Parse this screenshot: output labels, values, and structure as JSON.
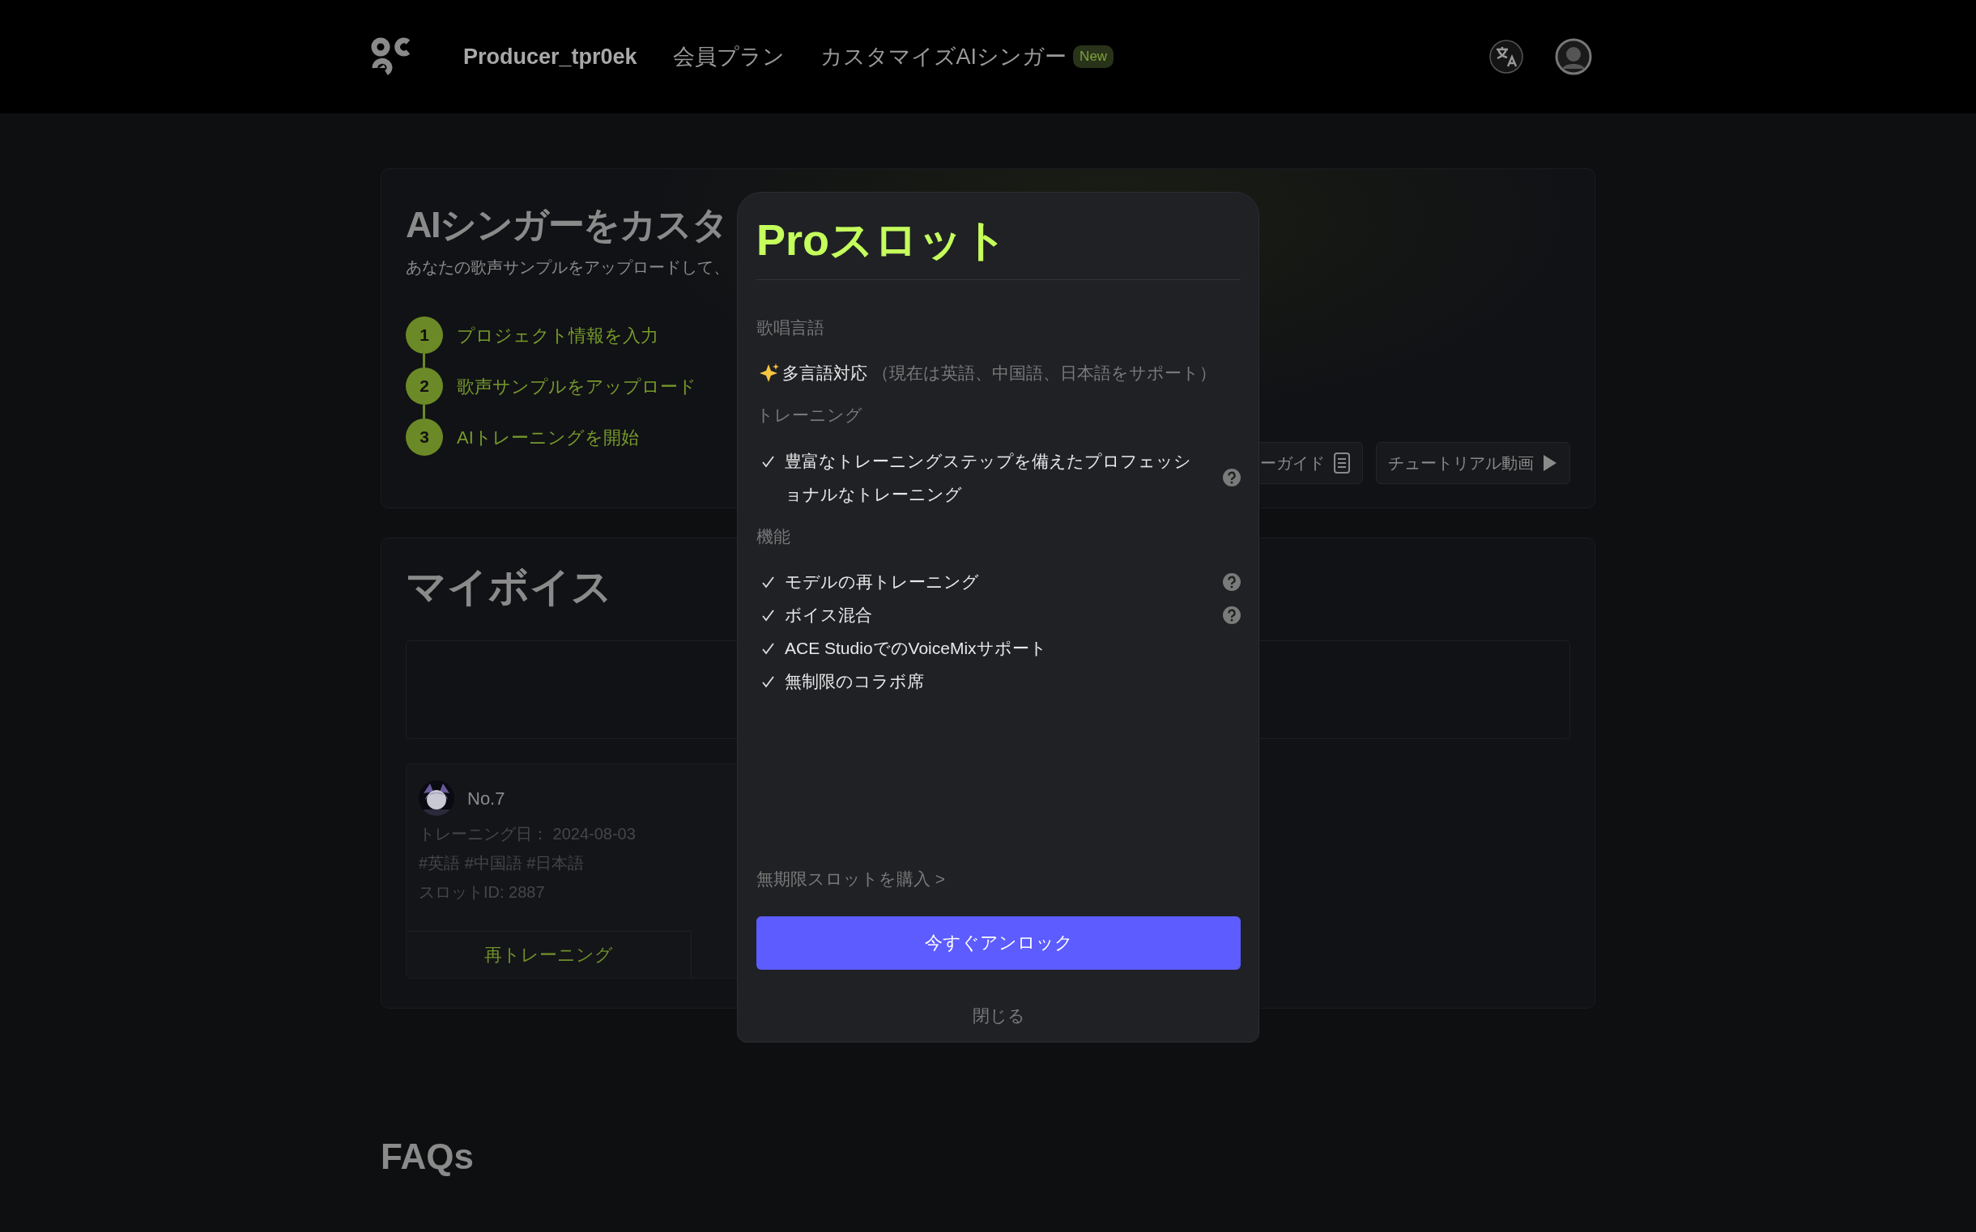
{
  "header": {
    "nav": [
      {
        "label": "Producer_tpr0ek",
        "kind": "user"
      },
      {
        "label": "会員プラン",
        "kind": "link"
      },
      {
        "label": "カスタマイズAIシンガー",
        "badge": "New",
        "kind": "link"
      }
    ]
  },
  "hero": {
    "title": "AIシンガーをカスタ",
    "subtitle": "あなたの歌声サンプルをアップロードして、",
    "steps": [
      {
        "number": "1",
        "label": "プロジェクト情報を入力"
      },
      {
        "number": "2",
        "label": "歌声サンプルをアップロード"
      },
      {
        "number": "3",
        "label": "AIトレーニングを開始"
      }
    ],
    "buttons": [
      {
        "label": "ーガイド",
        "kind": "guide"
      },
      {
        "label": "チュートリアル動画",
        "kind": "video"
      }
    ]
  },
  "voices": {
    "title": "マイボイス",
    "card": {
      "name": "No.7",
      "training_date": "トレーニング日： 2024-08-03",
      "tags": "#英語 #中国語 #日本語",
      "slot_id": "スロットID: 2887",
      "buttons": [
        "再トレーニング"
      ]
    }
  },
  "modal": {
    "title": "Proスロット",
    "sections": [
      {
        "heading": "歌唱言語",
        "items": [
          {
            "kind": "sparkle",
            "text": "多言語対応",
            "note": "（現在は英語、中国語、日本語をサポート）",
            "help": false
          }
        ]
      },
      {
        "heading": "トレーニング",
        "items": [
          {
            "kind": "check",
            "text": "豊富なトレーニングステップを備えたプロフェッショナルなトレーニング",
            "help": true
          }
        ]
      },
      {
        "heading": "機能",
        "items": [
          {
            "kind": "check",
            "text": "モデルの再トレーニング",
            "help": true
          },
          {
            "kind": "check",
            "text": "ボイス混合",
            "help": true
          },
          {
            "kind": "check",
            "text": "ACE StudioでのVoiceMixサポート",
            "help": false
          },
          {
            "kind": "check",
            "text": "無制限のコラボ席",
            "help": false
          }
        ]
      }
    ],
    "purchase_link": "無期限スロットを購入 >",
    "unlock_button": "今すぐアンロック",
    "close": "閉じる"
  },
  "faq": {
    "title": "FAQs"
  }
}
